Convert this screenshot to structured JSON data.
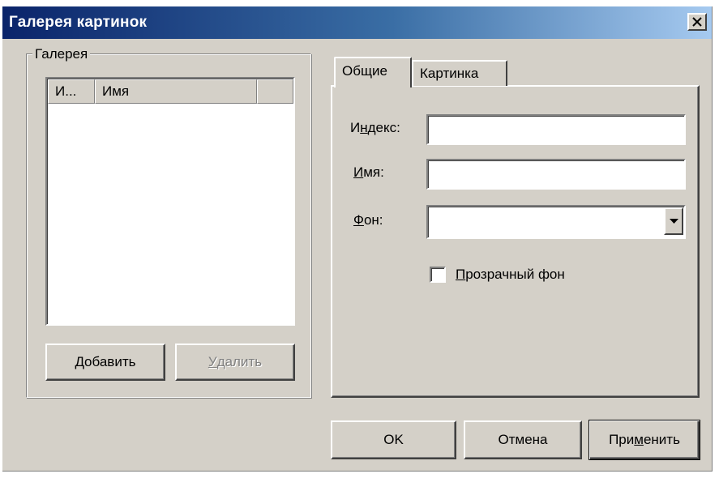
{
  "window": {
    "title": "Галерея картинок",
    "close_icon": "close-icon"
  },
  "gallery": {
    "group_label": "Галерея",
    "columns": [
      "И...",
      "Имя",
      ""
    ],
    "items": [],
    "add_button": {
      "pre": "",
      "accel": "Д",
      "post": "обавить"
    },
    "delete_button": {
      "pre": "",
      "accel": "У",
      "post": "далить",
      "disabled": true
    }
  },
  "tabs": [
    {
      "label": "Общие",
      "active": true
    },
    {
      "label": "Картинка",
      "active": false
    }
  ],
  "general": {
    "index_label": {
      "pre": "И",
      "accel": "н",
      "post": "декс:"
    },
    "index_value": "",
    "name_label": {
      "pre": "",
      "accel": "И",
      "post": "мя:"
    },
    "name_value": "",
    "background_label": {
      "pre": "",
      "accel": "Ф",
      "post": "он:"
    },
    "background_value": "",
    "transparent": {
      "pre": "",
      "accel": "П",
      "post": "розрачный фон",
      "checked": false
    }
  },
  "footer": {
    "ok": "OK",
    "cancel": "Отмена",
    "apply": {
      "pre": "При",
      "accel": "м",
      "post": "енить"
    }
  }
}
